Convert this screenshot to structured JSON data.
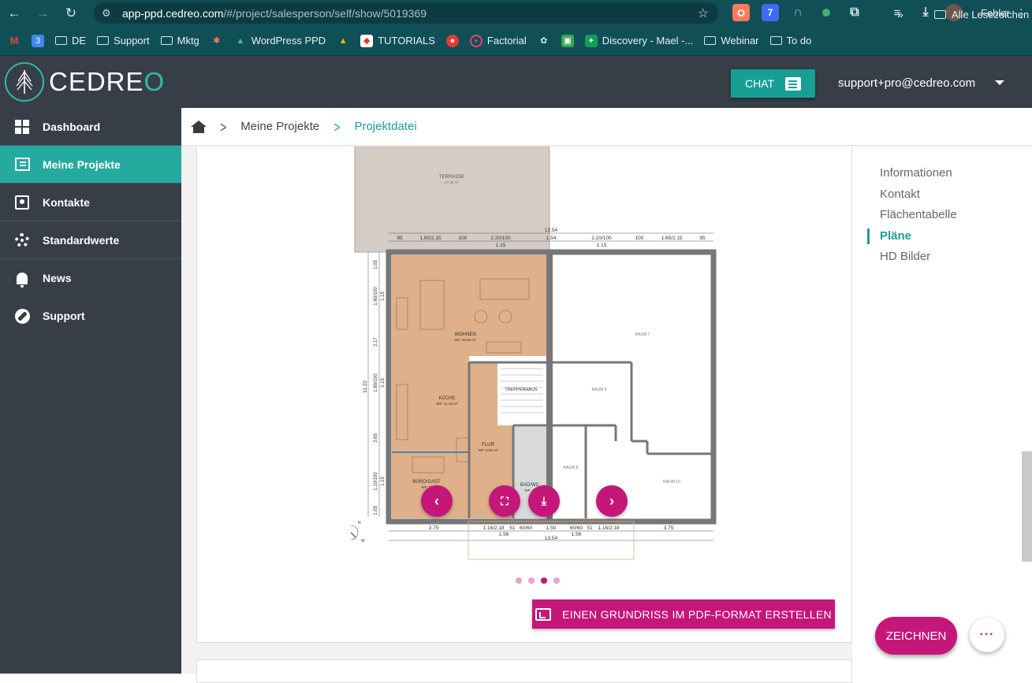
{
  "browser": {
    "url_host": "app-ppd.cedreo.com",
    "url_path": "/#/project/salesperson/self/show/5019369",
    "profile_status": "Fehler",
    "extensions": [
      {
        "name": "hubspot-ext",
        "color": "#ff7a59",
        "text": "⛭"
      },
      {
        "name": "badge-ext",
        "color": "#3d6cf1",
        "text": "7"
      }
    ],
    "bookmarks": [
      {
        "label": "",
        "icon": "gmail-icon"
      },
      {
        "label": "",
        "icon": "calendar-icon"
      },
      {
        "label": "DE",
        "icon": "folder-icon"
      },
      {
        "label": "Support",
        "icon": "folder-icon"
      },
      {
        "label": "Mktg",
        "icon": "folder-icon"
      },
      {
        "label": "",
        "icon": "hubspot-icon"
      },
      {
        "label": "WordPress PPD",
        "icon": "tree-icon"
      },
      {
        "label": "",
        "icon": "drive-icon"
      },
      {
        "label": "TUTORIALS",
        "icon": "app-icon"
      },
      {
        "label": "",
        "icon": "chrome-ext-icon"
      },
      {
        "label": "Factorial",
        "icon": "factorial-icon"
      },
      {
        "label": "",
        "icon": "openai-icon"
      },
      {
        "label": "",
        "icon": "meet-icon"
      },
      {
        "label": "Discovery - Mael -...",
        "icon": "sheets-icon"
      },
      {
        "label": "Webinar",
        "icon": "folder-icon"
      },
      {
        "label": "To do",
        "icon": "folder-icon"
      }
    ],
    "all_bookmarks": "Alle Lesezeichen",
    "more": "»"
  },
  "header": {
    "logo": "CEDREO",
    "chat_label": "CHAT",
    "user_email": "support+pro@cedreo.com"
  },
  "sidebar": {
    "items": [
      {
        "label": "Dashboard",
        "icon": "dashboard-icon",
        "active": false
      },
      {
        "label": "Meine Projekte",
        "icon": "projects-icon",
        "active": true
      },
      {
        "label": "Kontakte",
        "icon": "contacts-icon",
        "active": false
      },
      {
        "label": "Standardwerte",
        "icon": "gear-icon",
        "active": false
      },
      {
        "label": "News",
        "icon": "bell-icon",
        "active": false
      },
      {
        "label": "Support",
        "icon": "compass-icon",
        "active": false
      }
    ]
  },
  "breadcrumb": {
    "items": [
      "Meine Projekte",
      "Projektdatei"
    ]
  },
  "right_nav": {
    "items": [
      "Informationen",
      "Kontakt",
      "Flächentabelle",
      "Pläne",
      "HD Bilder"
    ],
    "active": "Pläne"
  },
  "plan": {
    "rooms": {
      "terrasse": "TERRASSE",
      "terrasse_area": "47.85 m²",
      "wohnen": "WOHNEN",
      "wohnen_area": "WF: 35.55 m²",
      "kueche": "KÜCHE",
      "kueche_area": "WF: 11.30 m²",
      "treppenhaus": "TREPPENHAUS",
      "flur": "FLUR",
      "flur_area": "WF: 8.52 m²",
      "buero": "BÜRO/GAST",
      "buero_area": "WF: 7.",
      "bad": "BAD/WC",
      "bad_area": "WF: 4.",
      "raum7": "RAUM 7",
      "raum8": "RAUM 8",
      "raum9": "RAUM 9",
      "raum10": "RAUM 10"
    },
    "dims_top": [
      "95",
      "1.65/2.15",
      "100",
      "2.20/100",
      "1.54",
      "2.20/100",
      "100",
      "1.65/2.15",
      "95"
    ],
    "dims_top_sub": [
      "1.15",
      "1.15"
    ],
    "dims_top_total": "13.54",
    "dims_bottom": [
      "3.75",
      "1.16/2.18",
      "51",
      "60/60",
      "1.50",
      "60/60",
      "51",
      "1.16/2.18",
      "3.75"
    ],
    "dims_bottom_sub": [
      "1.56",
      "1.56"
    ],
    "dims_bottom_total": "13.54",
    "dims_left": [
      "1.05",
      "1.60/100",
      "1.15",
      "2.17",
      "1.60/100",
      "1.15",
      "2.65",
      "1.10/100",
      "1.15",
      "1.05"
    ],
    "dims_left_total": "11.22",
    "compass": [
      "N",
      "S",
      "O",
      "W"
    ],
    "slide_count": 4,
    "slide_active": 2
  },
  "actions": {
    "pdf_label": "EINEN GRUNDRISS IM PDF-FORMAT ERSTELLEN",
    "draw_label": "ZEICHNEN",
    "more_label": "···"
  },
  "colors": {
    "teal": "#25aaa0",
    "magenta": "#c5167a",
    "dark": "#373e48",
    "chrome": "#114f57",
    "room_fill": "#e0b08a"
  }
}
